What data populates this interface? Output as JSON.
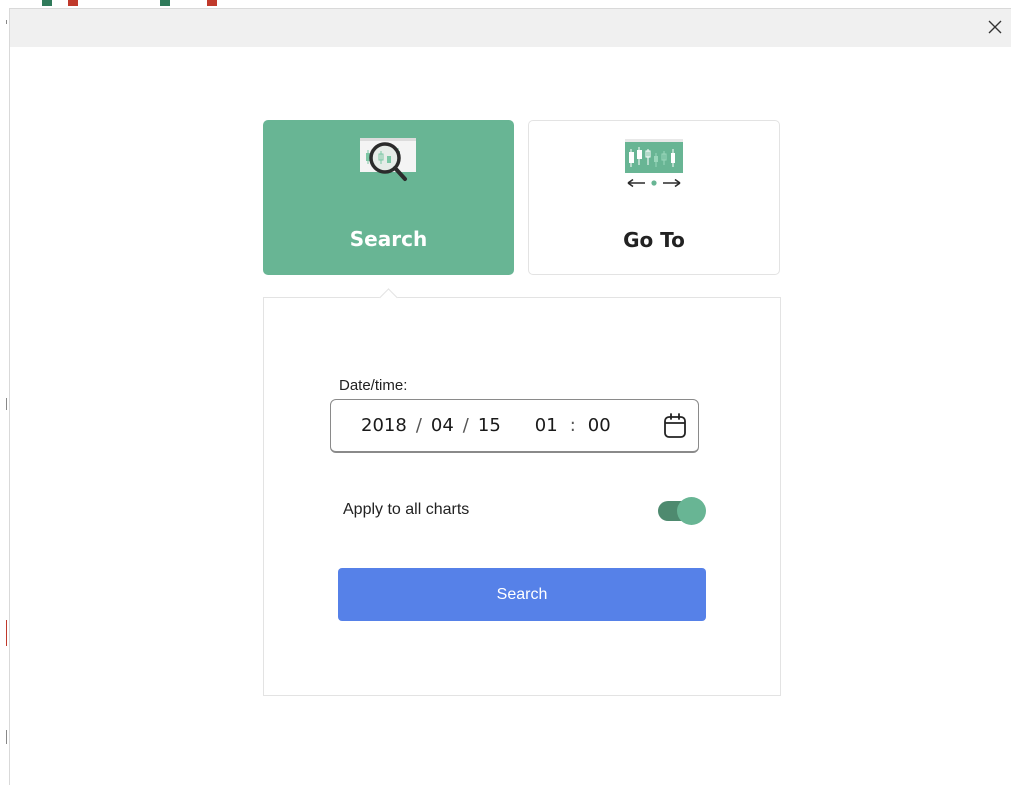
{
  "dialog": {
    "close_icon": "close-icon"
  },
  "tabs": [
    {
      "label": "Search",
      "icon": "candlestick-magnifier-icon",
      "active": true
    },
    {
      "label": "Go To",
      "icon": "candlestick-arrows-icon",
      "active": false
    }
  ],
  "form": {
    "datetime_label": "Date/time:",
    "year": "2018",
    "month": "04",
    "day": "15",
    "hour": "01",
    "minute": "00",
    "date_separator": "/",
    "time_separator": ":",
    "calendar_icon": "calendar-icon",
    "apply_label": "Apply to all charts",
    "apply_enabled": true,
    "submit_label": "Search"
  },
  "colors": {
    "accent_green": "#68b594",
    "button_blue": "#5681e8"
  }
}
